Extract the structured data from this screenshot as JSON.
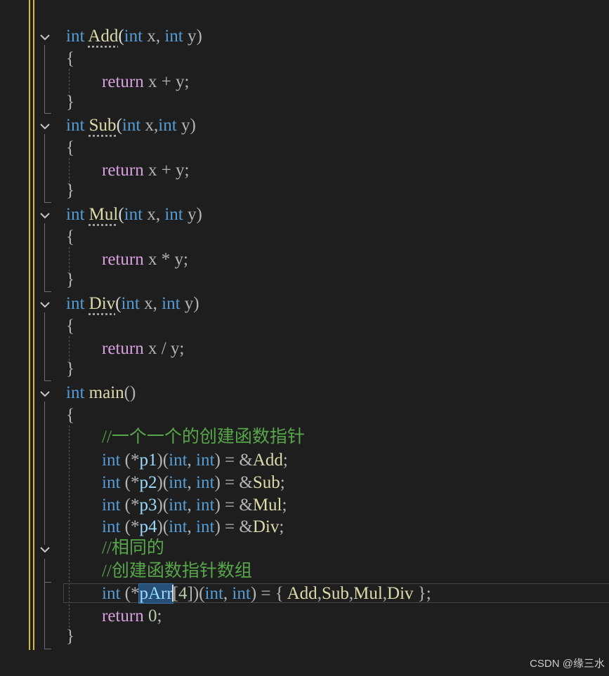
{
  "code": {
    "add_sig": {
      "kw1": "int",
      "name": "Add",
      "open": "(",
      "kw2": "int",
      "p1": " x, ",
      "kw3": "int",
      "p2": " y)"
    },
    "sub_sig": {
      "kw1": "int",
      "name": "Sub",
      "open": "(",
      "kw2": "int",
      "p1": " x,",
      "kw3": "int",
      "p2": " y)"
    },
    "mul_sig": {
      "kw1": "int",
      "name": "Mul",
      "open": "(",
      "kw2": "int",
      "p1": " x, ",
      "kw3": "int",
      "p2": " y)"
    },
    "div_sig": {
      "kw1": "int",
      "name": "Div",
      "open": "(",
      "kw2": "int",
      "p1": " x, ",
      "kw3": "int",
      "p2": " y)"
    },
    "brace_open": "{",
    "brace_close": "}",
    "ret_kw": "return",
    "add_body": " x + y;",
    "sub_body": " x + y;",
    "mul_body": " x * y;",
    "div_body": " x / y;",
    "main_sig": {
      "kw": "int",
      "name": "main",
      "rest": "()"
    },
    "comment1": "//一个一个的创建函数指针",
    "ptr_lines": [
      {
        "kw1": "int",
        "a": " (*",
        "var": "p1",
        "b": ")(",
        "kw2": "int",
        "c": ", ",
        "kw3": "int",
        "d": ") = &",
        "fn": "Add",
        "e": ";"
      },
      {
        "kw1": "int",
        "a": " (*",
        "var": "p2",
        "b": ")(",
        "kw2": "int",
        "c": ", ",
        "kw3": "int",
        "d": ") = &",
        "fn": "Sub",
        "e": ";"
      },
      {
        "kw1": "int",
        "a": " (*",
        "var": "p3",
        "b": ")(",
        "kw2": "int",
        "c": ", ",
        "kw3": "int",
        "d": ") = &",
        "fn": "Mul",
        "e": ";"
      },
      {
        "kw1": "int",
        "a": " (*",
        "var": "p4",
        "b": ")(",
        "kw2": "int",
        "c": ", ",
        "kw3": "int",
        "d": ") = &",
        "fn": "Div",
        "e": ";"
      }
    ],
    "comment2": "//相同的",
    "comment3": "//创建函数指针数组",
    "arr_line": {
      "kw1": "int",
      "a": " (*",
      "var": "pArr",
      "idx_open": "[",
      "idx": "4",
      "idx_close": "]",
      "b": ")(",
      "kw2": "int",
      "c": ", ",
      "kw3": "int",
      "d": ") = { ",
      "f1": "Add",
      "s1": ",",
      "f2": "Sub",
      "s2": ",",
      "f3": "Mul",
      "s3": ",",
      "f4": "Div",
      "e": " };"
    },
    "ret0": {
      "kw": "return",
      "num": "0",
      "semi": ";"
    }
  },
  "watermark": "CSDN @缘三水",
  "colors": {
    "background": "#1e1e1e",
    "keyword": "#569cd6",
    "function": "#dcdcaa",
    "control": "#d8a0df",
    "variable": "#9cdcfe",
    "comment": "#57a64a",
    "number": "#b5cea8",
    "change_bar": "#d7ba2d",
    "selection": "#264f78"
  },
  "icons": {
    "fold": "chevron-down-icon"
  }
}
